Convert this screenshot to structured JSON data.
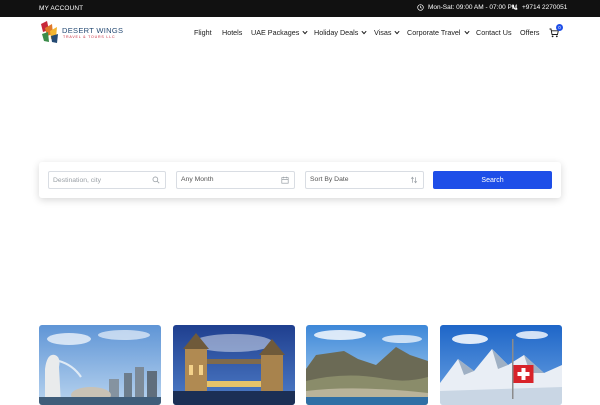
{
  "topbar": {
    "account_label": "MY ACCOUNT",
    "hours": "Mon-Sat: 09:00 AM - 07:00 PM",
    "phone": "+9714 2270051"
  },
  "logo": {
    "brand": "DESERT WINGS",
    "tagline": "TRAVEL & TOURS LLC"
  },
  "nav": {
    "items": [
      {
        "label": "Flight",
        "dropdown": false
      },
      {
        "label": "Hotels",
        "dropdown": false
      },
      {
        "label": "UAE Packages",
        "dropdown": true
      },
      {
        "label": "Holiday Deals",
        "dropdown": true
      },
      {
        "label": "Visas",
        "dropdown": true
      },
      {
        "label": "Corporate Travel",
        "dropdown": true
      },
      {
        "label": "Contact Us",
        "dropdown": false
      },
      {
        "label": "Offers",
        "dropdown": false
      }
    ],
    "cart_count": "0"
  },
  "search": {
    "destination_placeholder": "Destination, city",
    "month_value": "Any Month",
    "sort_value": "Sort By Date",
    "button_label": "Search"
  },
  "colors": {
    "accent": "#1e4ee8",
    "topbar_bg": "#111111",
    "brand_blue": "#244a73",
    "brand_red": "#c8283a"
  },
  "cards": [
    {
      "icon": "singapore-merlion-image"
    },
    {
      "icon": "london-tower-bridge-image"
    },
    {
      "icon": "cape-town-table-mountain-image"
    },
    {
      "icon": "switzerland-alps-flag-image"
    }
  ]
}
